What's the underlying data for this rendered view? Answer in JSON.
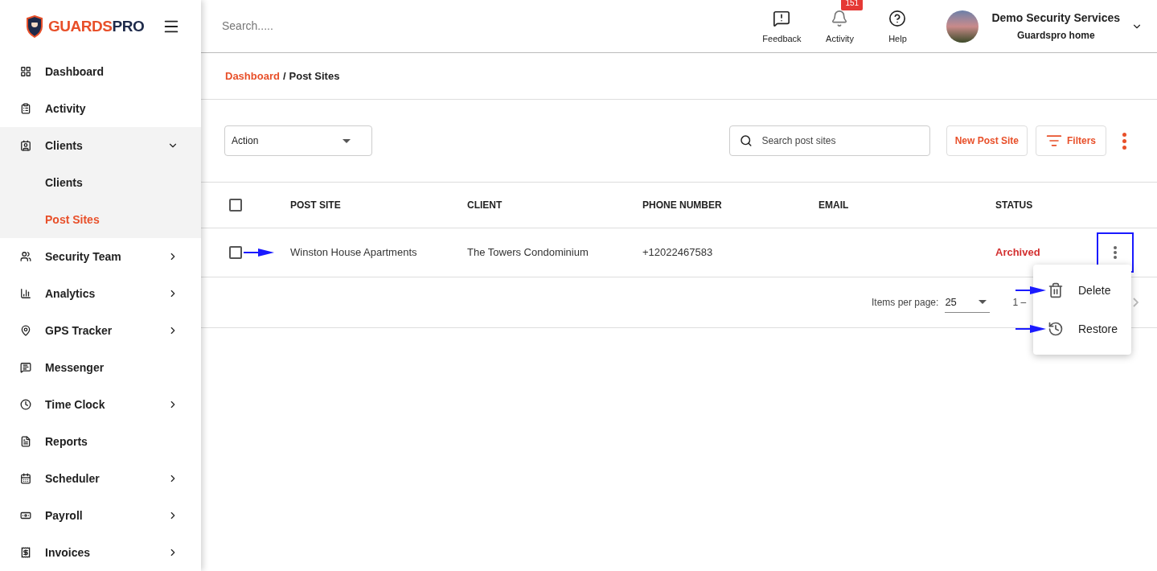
{
  "brand": {
    "name_part_1": "GUARDS",
    "name_part_2": "PRO"
  },
  "sidebar": {
    "items": [
      {
        "label": "Dashboard",
        "expandable": false,
        "expanded": false
      },
      {
        "label": "Activity",
        "expandable": false,
        "expanded": false
      },
      {
        "label": "Clients",
        "expandable": true,
        "expanded": true,
        "children": [
          {
            "label": "Clients",
            "selected": false
          },
          {
            "label": "Post Sites",
            "selected": true
          }
        ]
      },
      {
        "label": "Security Team",
        "expandable": true,
        "expanded": false
      },
      {
        "label": "Analytics",
        "expandable": true,
        "expanded": false
      },
      {
        "label": "GPS Tracker",
        "expandable": true,
        "expanded": false
      },
      {
        "label": "Messenger",
        "expandable": false,
        "expanded": false
      },
      {
        "label": "Time Clock",
        "expandable": true,
        "expanded": false
      },
      {
        "label": "Reports",
        "expandable": false,
        "expanded": false
      },
      {
        "label": "Scheduler",
        "expandable": true,
        "expanded": false
      },
      {
        "label": "Payroll",
        "expandable": true,
        "expanded": false
      },
      {
        "label": "Invoices",
        "expandable": true,
        "expanded": false
      }
    ]
  },
  "header": {
    "search": {
      "placeholder": "Search....."
    },
    "actions": [
      {
        "label": "Feedback"
      },
      {
        "label": "Activity",
        "badge": "151"
      },
      {
        "label": "Help"
      }
    ],
    "account": {
      "name": "Demo Security Services",
      "subtitle": "Guardspro home"
    }
  },
  "breadcrumb": {
    "link": "Dashboard",
    "separator": "/",
    "current": "Post Sites"
  },
  "toolbar": {
    "action_select": "Action",
    "search": {
      "placeholder": "Search post sites"
    },
    "new_button": "New Post Site",
    "filters_button": "Filters"
  },
  "table": {
    "columns": [
      "POST SITE",
      "CLIENT",
      "PHONE NUMBER",
      "EMAIL",
      "STATUS"
    ],
    "header_checked": false,
    "rows": [
      {
        "checked": false,
        "cells": [
          "Winston House Apartments",
          "The Towers Condominium",
          "+12022467583",
          ""
        ],
        "status": "Archived",
        "menu_open": true
      }
    ]
  },
  "row_menu": {
    "items": [
      {
        "label": "Delete"
      },
      {
        "label": "Restore"
      }
    ]
  },
  "pagination": {
    "label": "Items per page:",
    "page_size": "25",
    "range": "1 –"
  }
}
